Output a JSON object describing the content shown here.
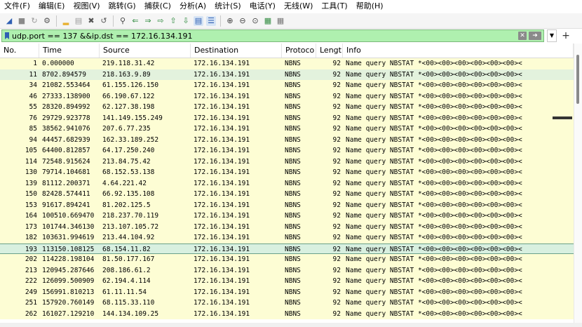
{
  "menu": [
    "文件(F)",
    "编辑(E)",
    "视图(V)",
    "跳转(G)",
    "捕获(C)",
    "分析(A)",
    "统计(S)",
    "电话(Y)",
    "无线(W)",
    "工具(T)",
    "帮助(H)"
  ],
  "toolbar_icons": [
    "shark-fin-start-icon",
    "stop-square-icon",
    "restart-shark-icon",
    "gear-options-icon",
    "open-folder-icon",
    "file-icon",
    "close-file-icon",
    "reload-icon",
    "search-icon",
    "back-arrow-icon",
    "forward-arrow-icon",
    "go-to-packet-icon",
    "first-packet-icon",
    "last-packet-icon",
    "autoscroll-icon",
    "colorize-icon",
    "zoom-in-icon",
    "zoom-out-icon",
    "zoom-reset-icon",
    "resize-columns-icon",
    "layout-icon"
  ],
  "filter": {
    "value": "udp.port == 137 &&ip.dst == 172.16.134.191",
    "plus": "+"
  },
  "columns": [
    "No.",
    "Time",
    "Source",
    "Destination",
    "Protoco",
    "Lengt",
    "Info"
  ],
  "rows": [
    {
      "no": "1",
      "time": "0.000000",
      "src": "219.118.31.42",
      "dst": "172.16.134.191",
      "proto": "NBNS",
      "len": "92",
      "info": "Name query NBSTAT *<00><00><00><00><00><00><"
    },
    {
      "no": "11",
      "time": "8702.894579",
      "src": "218.163.9.89",
      "dst": "172.16.134.191",
      "proto": "NBNS",
      "len": "92",
      "info": "Name query NBSTAT *<00><00><00><00><00><00><"
    },
    {
      "no": "34",
      "time": "21082.553464",
      "src": "61.155.126.150",
      "dst": "172.16.134.191",
      "proto": "NBNS",
      "len": "92",
      "info": "Name query NBSTAT *<00><00><00><00><00><00><"
    },
    {
      "no": "46",
      "time": "27333.138900",
      "src": "66.190.67.122",
      "dst": "172.16.134.191",
      "proto": "NBNS",
      "len": "92",
      "info": "Name query NBSTAT *<00><00><00><00><00><00><"
    },
    {
      "no": "55",
      "time": "28320.894992",
      "src": "62.127.38.198",
      "dst": "172.16.134.191",
      "proto": "NBNS",
      "len": "92",
      "info": "Name query NBSTAT *<00><00><00><00><00><00><"
    },
    {
      "no": "76",
      "time": "29729.923778",
      "src": "141.149.155.249",
      "dst": "172.16.134.191",
      "proto": "NBNS",
      "len": "92",
      "info": "Name query NBSTAT *<00><00><00><00><00><00><"
    },
    {
      "no": "85",
      "time": "38562.941076",
      "src": "207.6.77.235",
      "dst": "172.16.134.191",
      "proto": "NBNS",
      "len": "92",
      "info": "Name query NBSTAT *<00><00><00><00><00><00><"
    },
    {
      "no": "94",
      "time": "44457.682939",
      "src": "162.33.189.252",
      "dst": "172.16.134.191",
      "proto": "NBNS",
      "len": "92",
      "info": "Name query NBSTAT *<00><00><00><00><00><00><"
    },
    {
      "no": "105",
      "time": "64400.812857",
      "src": "64.17.250.240",
      "dst": "172.16.134.191",
      "proto": "NBNS",
      "len": "92",
      "info": "Name query NBSTAT *<00><00><00><00><00><00><"
    },
    {
      "no": "114",
      "time": "72548.915624",
      "src": "213.84.75.42",
      "dst": "172.16.134.191",
      "proto": "NBNS",
      "len": "92",
      "info": "Name query NBSTAT *<00><00><00><00><00><00><"
    },
    {
      "no": "130",
      "time": "79714.104681",
      "src": "68.152.53.138",
      "dst": "172.16.134.191",
      "proto": "NBNS",
      "len": "92",
      "info": "Name query NBSTAT *<00><00><00><00><00><00><"
    },
    {
      "no": "139",
      "time": "81112.200371",
      "src": "4.64.221.42",
      "dst": "172.16.134.191",
      "proto": "NBNS",
      "len": "92",
      "info": "Name query NBSTAT *<00><00><00><00><00><00><"
    },
    {
      "no": "150",
      "time": "82428.574411",
      "src": "66.92.135.108",
      "dst": "172.16.134.191",
      "proto": "NBNS",
      "len": "92",
      "info": "Name query NBSTAT *<00><00><00><00><00><00><"
    },
    {
      "no": "153",
      "time": "91617.894241",
      "src": "81.202.125.5",
      "dst": "172.16.134.191",
      "proto": "NBNS",
      "len": "92",
      "info": "Name query NBSTAT *<00><00><00><00><00><00><"
    },
    {
      "no": "164",
      "time": "100510.669470",
      "src": "218.237.70.119",
      "dst": "172.16.134.191",
      "proto": "NBNS",
      "len": "92",
      "info": "Name query NBSTAT *<00><00><00><00><00><00><"
    },
    {
      "no": "173",
      "time": "101744.346130",
      "src": "213.107.105.72",
      "dst": "172.16.134.191",
      "proto": "NBNS",
      "len": "92",
      "info": "Name query NBSTAT *<00><00><00><00><00><00><"
    },
    {
      "no": "182",
      "time": "103631.994619",
      "src": "213.44.104.92",
      "dst": "172.16.134.191",
      "proto": "NBNS",
      "len": "92",
      "info": "Name query NBSTAT *<00><00><00><00><00><00><"
    },
    {
      "no": "193",
      "time": "113150.108125",
      "src": "68.154.11.82",
      "dst": "172.16.134.191",
      "proto": "NBNS",
      "len": "92",
      "info": "Name query NBSTAT *<00><00><00><00><00><00><"
    },
    {
      "no": "202",
      "time": "114228.198104",
      "src": "81.50.177.167",
      "dst": "172.16.134.191",
      "proto": "NBNS",
      "len": "92",
      "info": "Name query NBSTAT *<00><00><00><00><00><00><"
    },
    {
      "no": "213",
      "time": "120945.287646",
      "src": "208.186.61.2",
      "dst": "172.16.134.191",
      "proto": "NBNS",
      "len": "92",
      "info": "Name query NBSTAT *<00><00><00><00><00><00><"
    },
    {
      "no": "222",
      "time": "126099.500909",
      "src": "62.194.4.114",
      "dst": "172.16.134.191",
      "proto": "NBNS",
      "len": "92",
      "info": "Name query NBSTAT *<00><00><00><00><00><00><"
    },
    {
      "no": "249",
      "time": "156991.810213",
      "src": "61.11.11.54",
      "dst": "172.16.134.191",
      "proto": "NBNS",
      "len": "92",
      "info": "Name query NBSTAT *<00><00><00><00><00><00><"
    },
    {
      "no": "251",
      "time": "157920.760149",
      "src": "68.115.33.110",
      "dst": "172.16.134.191",
      "proto": "NBNS",
      "len": "92",
      "info": "Name query NBSTAT *<00><00><00><00><00><00><"
    },
    {
      "no": "262",
      "time": "161027.129210",
      "src": "144.134.109.25",
      "dst": "172.16.134.191",
      "proto": "NBNS",
      "len": "92",
      "info": "Name query NBSTAT *<00><00><00><00><00><00><"
    }
  ],
  "selected_row": "193",
  "highlighted_row": "11",
  "colors": {
    "row_bg": "#fdfdd4",
    "selected_bg": "#d8f0e0",
    "filter_bg": "#aff0af",
    "accent": "#2f5fb3"
  }
}
